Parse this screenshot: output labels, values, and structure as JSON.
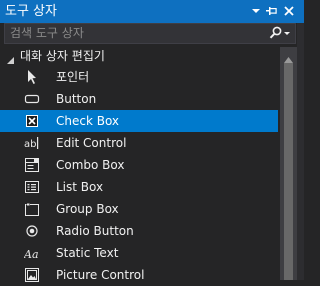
{
  "panel": {
    "title": "도구 상자",
    "buttons": {
      "dropdown": "chevron-down-icon",
      "pin": "pin-icon",
      "close": "close-icon"
    },
    "accent": "#0e70c0"
  },
  "search": {
    "placeholder": "검색 도구 상자",
    "icon": "search-icon"
  },
  "group": {
    "label": "대화 상자 편집기",
    "expanded": true
  },
  "items": [
    {
      "label": "포인터",
      "icon": "pointer-icon",
      "selected": false
    },
    {
      "label": "Button",
      "icon": "button-icon",
      "selected": false
    },
    {
      "label": "Check Box",
      "icon": "checkbox-icon",
      "selected": true
    },
    {
      "label": "Edit Control",
      "icon": "edit-control-icon",
      "selected": false
    },
    {
      "label": "Combo Box",
      "icon": "combo-box-icon",
      "selected": false
    },
    {
      "label": "List Box",
      "icon": "list-box-icon",
      "selected": false
    },
    {
      "label": "Group Box",
      "icon": "group-box-icon",
      "selected": false
    },
    {
      "label": "Radio Button",
      "icon": "radio-button-icon",
      "selected": false
    },
    {
      "label": "Static Text",
      "icon": "static-text-icon",
      "selected": false
    },
    {
      "label": "Picture Control",
      "icon": "picture-control-icon",
      "selected": false
    }
  ],
  "colors": {
    "background": "#252526",
    "selection": "#007acc",
    "text": "#f1f1f1"
  }
}
